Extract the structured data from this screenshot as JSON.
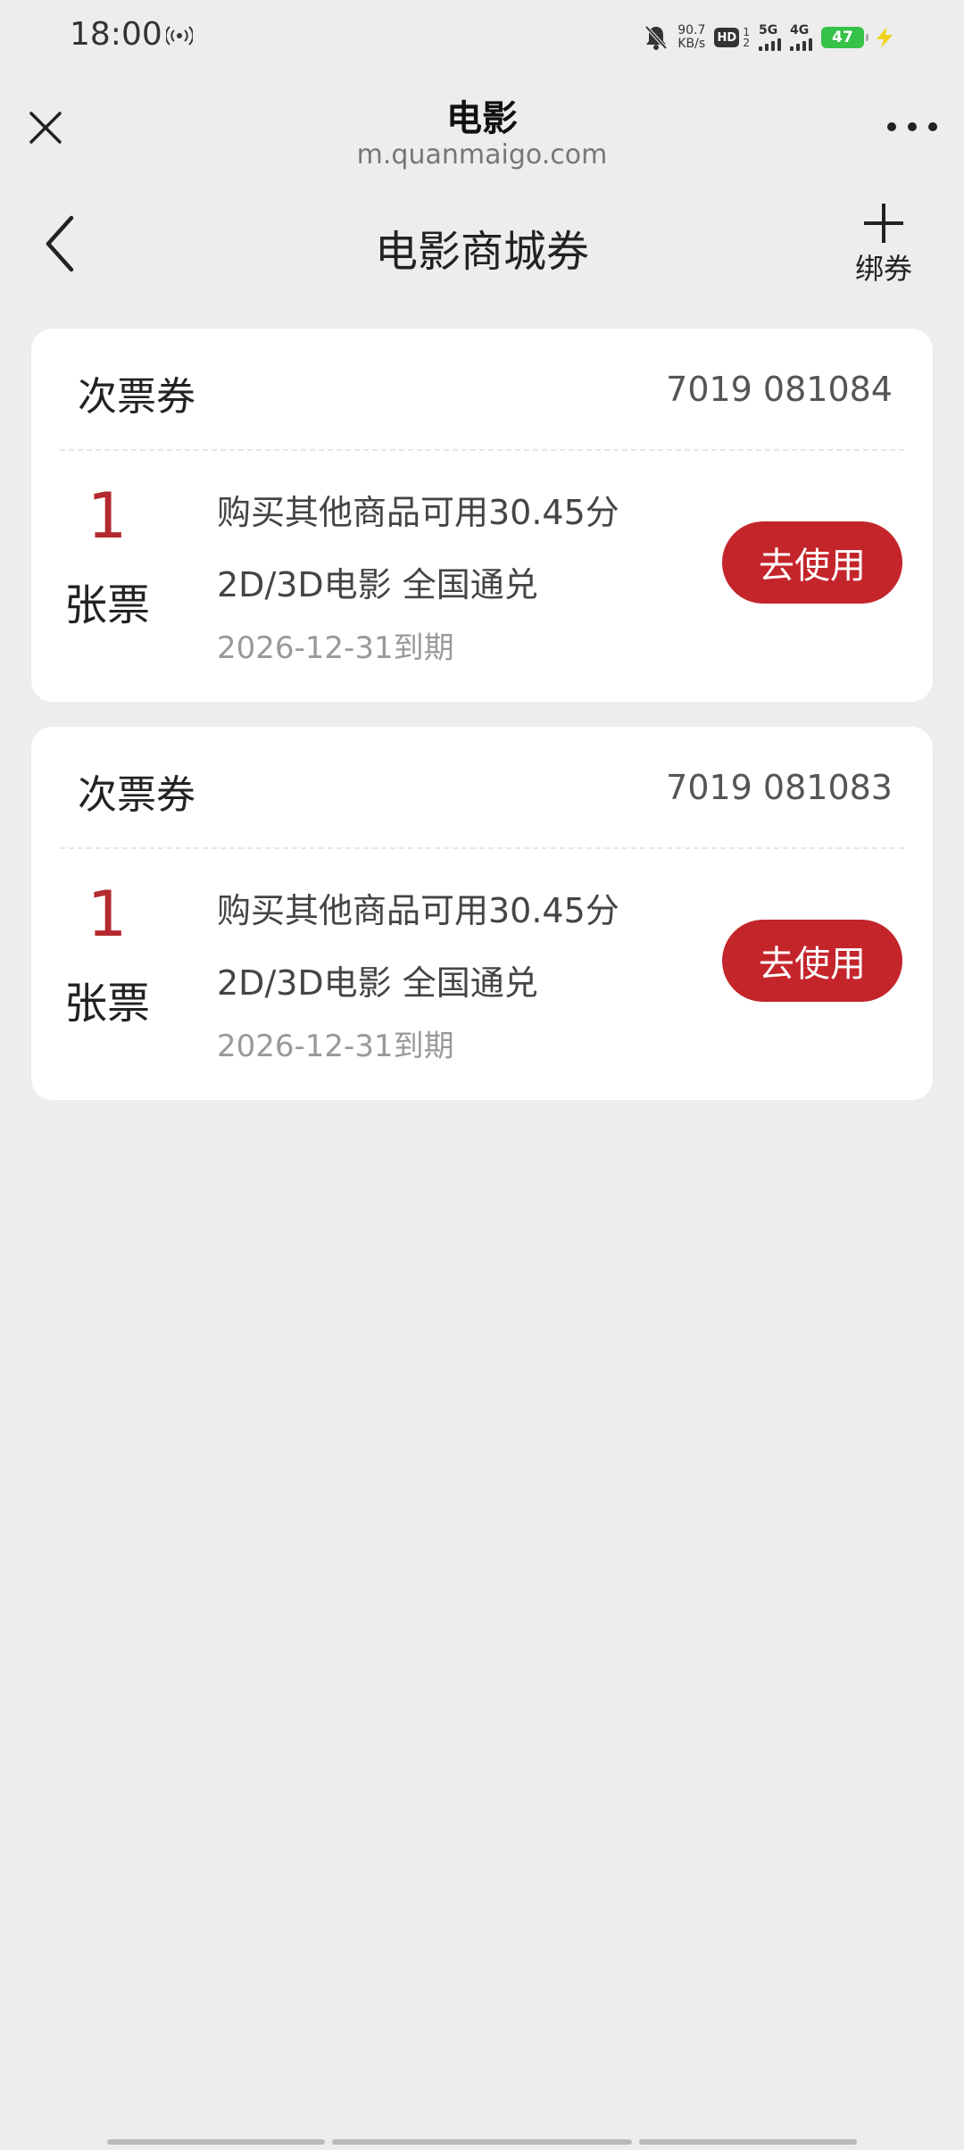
{
  "status_bar": {
    "time": "18:00",
    "speed_value": "90.7",
    "speed_unit": "KB/s",
    "hd_label": "HD",
    "sim_sub_top": "1",
    "sim_sub_bottom": "2",
    "network1": "5G",
    "network2": "4G",
    "battery": "47"
  },
  "browser": {
    "title": "电影",
    "url": "m.quanmaigo.com"
  },
  "page": {
    "title": "电影商城券",
    "bind_label": "绑券"
  },
  "coupons": [
    {
      "type": "次票券",
      "code": "7019 081084",
      "count": "1",
      "unit": "张票",
      "desc1": "购买其他商品可用30.45分",
      "desc2": "2D/3D电影 全国通兑",
      "expiry": "2026-12-31到期",
      "button": "去使用"
    },
    {
      "type": "次票券",
      "code": "7019 081083",
      "count": "1",
      "unit": "张票",
      "desc1": "购买其他商品可用30.45分",
      "desc2": "2D/3D电影 全国通兑",
      "expiry": "2026-12-31到期",
      "button": "去使用"
    }
  ],
  "colors": {
    "accent": "#c4252b",
    "count_red": "#b52a2e",
    "background": "#ededed",
    "battery_green": "#35c248"
  }
}
